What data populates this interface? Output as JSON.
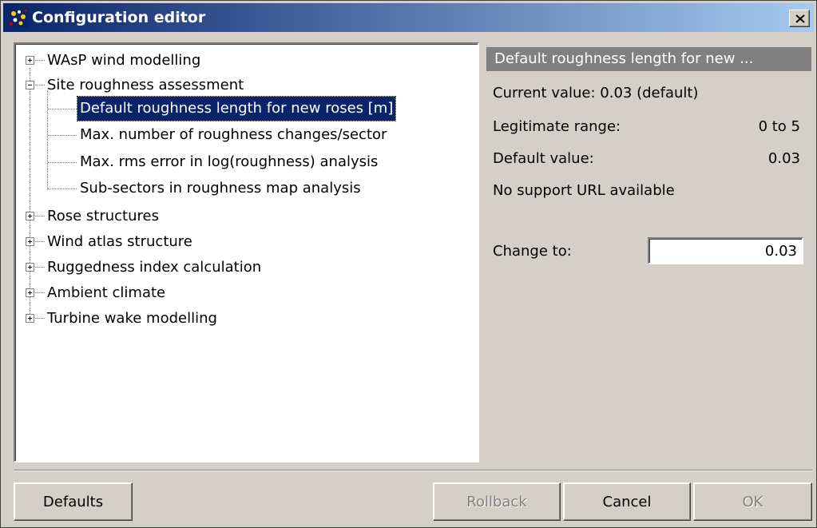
{
  "window": {
    "title": "Configuration editor",
    "app_icon": "wasp-app-icon",
    "close_icon": "close-x-icon"
  },
  "tree": {
    "items": [
      {
        "label": "WAsP wind modelling",
        "expander": "+"
      },
      {
        "label": "Site roughness assessment",
        "expander": "−",
        "children": [
          {
            "label": "Default roughness length for new roses [m]",
            "selected": true
          },
          {
            "label": "Max. number of roughness changes/sector"
          },
          {
            "label": "Max. rms error in log(roughness) analysis"
          },
          {
            "label": "Sub-sectors in roughness map analysis"
          }
        ]
      },
      {
        "label": "Rose structures",
        "expander": "+"
      },
      {
        "label": "Wind atlas structure",
        "expander": "+"
      },
      {
        "label": "Ruggedness index calculation",
        "expander": "+"
      },
      {
        "label": "Ambient climate",
        "expander": "+"
      },
      {
        "label": "Turbine wake modelling",
        "expander": "+"
      }
    ]
  },
  "details": {
    "title": "Default roughness length for new ...",
    "current_value": "Current value: 0.03 (default)",
    "range_label": "Legitimate range:",
    "range_value": "0 to 5",
    "default_label": "Default value:",
    "default_value": "0.03",
    "support_url": "No support URL available",
    "change_label": "Change to:",
    "change_value": "0.03"
  },
  "buttons": {
    "defaults": "Defaults",
    "rollback": "Rollback",
    "cancel": "Cancel",
    "ok": "OK"
  },
  "colors": {
    "title_start": "#0a246a",
    "title_end": "#a6caf0",
    "selection": "#0a246a",
    "face": "#d4d0c8"
  }
}
